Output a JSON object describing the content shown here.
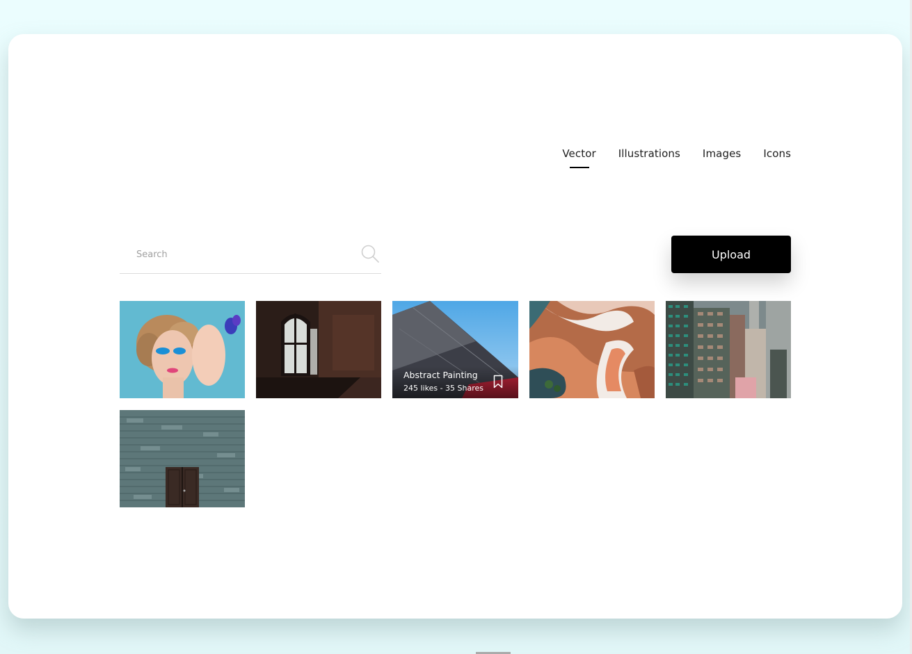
{
  "nav": {
    "items": [
      {
        "label": "Vector",
        "active": true
      },
      {
        "label": "Illustrations",
        "active": false
      },
      {
        "label": "Images",
        "active": false
      },
      {
        "label": "Icons",
        "active": false
      }
    ]
  },
  "search": {
    "placeholder": "Search",
    "value": ""
  },
  "upload": {
    "label": "Upload"
  },
  "gallery": {
    "images": [
      {
        "subject": "woman-with-blue-eyeshadow"
      },
      {
        "subject": "dark-room-window"
      },
      {
        "subject": "abstract-building-sky",
        "title": "Abstract Painting",
        "meta": "245 likes - 35 Shares"
      },
      {
        "subject": "aerial-abstract-landscape"
      },
      {
        "subject": "city-skyscrapers"
      },
      {
        "subject": "stone-wall-door"
      }
    ]
  },
  "colors": {
    "page_bg": "#e8fcfd",
    "card_bg": "#ffffff",
    "accent": "#000000",
    "upload_text": "#ffffff"
  }
}
